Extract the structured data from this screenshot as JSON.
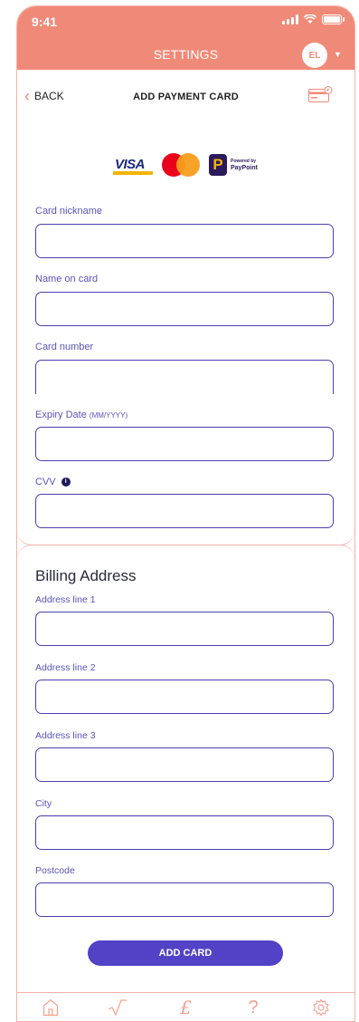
{
  "status": {
    "time": "9:41"
  },
  "header": {
    "title": "SETTINGS",
    "avatar_initials": "EL"
  },
  "subnav": {
    "back_label": "BACK",
    "title": "ADD PAYMENT CARD"
  },
  "logos": {
    "visa": "VISA",
    "paypoint_tag": "Powered by",
    "paypoint_name": "PayPoint"
  },
  "card_form": {
    "nickname_label": "Card nickname",
    "name_label": "Name on card",
    "number_label": "Card number",
    "expiry_label": "Expiry Date",
    "expiry_hint": "(MM/YYYY)",
    "cvv_label": "CVV",
    "cvv_info": "i"
  },
  "billing": {
    "title": "Billing Address",
    "address1_label": "Address line 1",
    "address2_label": "Address line 2",
    "address3_label": "Address line 3",
    "city_label": "City",
    "postcode_label": "Postcode"
  },
  "add_button": "ADD CARD",
  "tabbar": {
    "items": [
      "home-icon",
      "chart-icon",
      "pound-icon",
      "help-icon",
      "settings-icon"
    ]
  },
  "colors": {
    "accent": "#f08a78",
    "primary": "#5142c6",
    "field_border": "#4b3fb0",
    "label": "#5b53b8"
  }
}
